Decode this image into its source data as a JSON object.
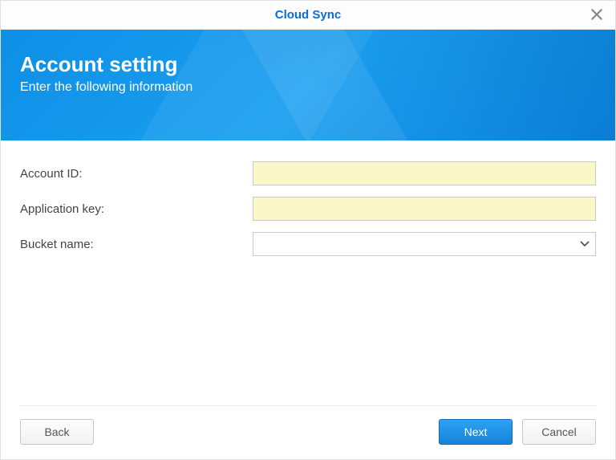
{
  "window": {
    "title": "Cloud Sync"
  },
  "banner": {
    "heading": "Account setting",
    "subtitle": "Enter the following information"
  },
  "form": {
    "account_id": {
      "label": "Account ID:",
      "value": ""
    },
    "application_key": {
      "label": "Application key:",
      "value": ""
    },
    "bucket_name": {
      "label": "Bucket name:",
      "value": ""
    }
  },
  "footer": {
    "back_label": "Back",
    "next_label": "Next",
    "cancel_label": "Cancel"
  }
}
